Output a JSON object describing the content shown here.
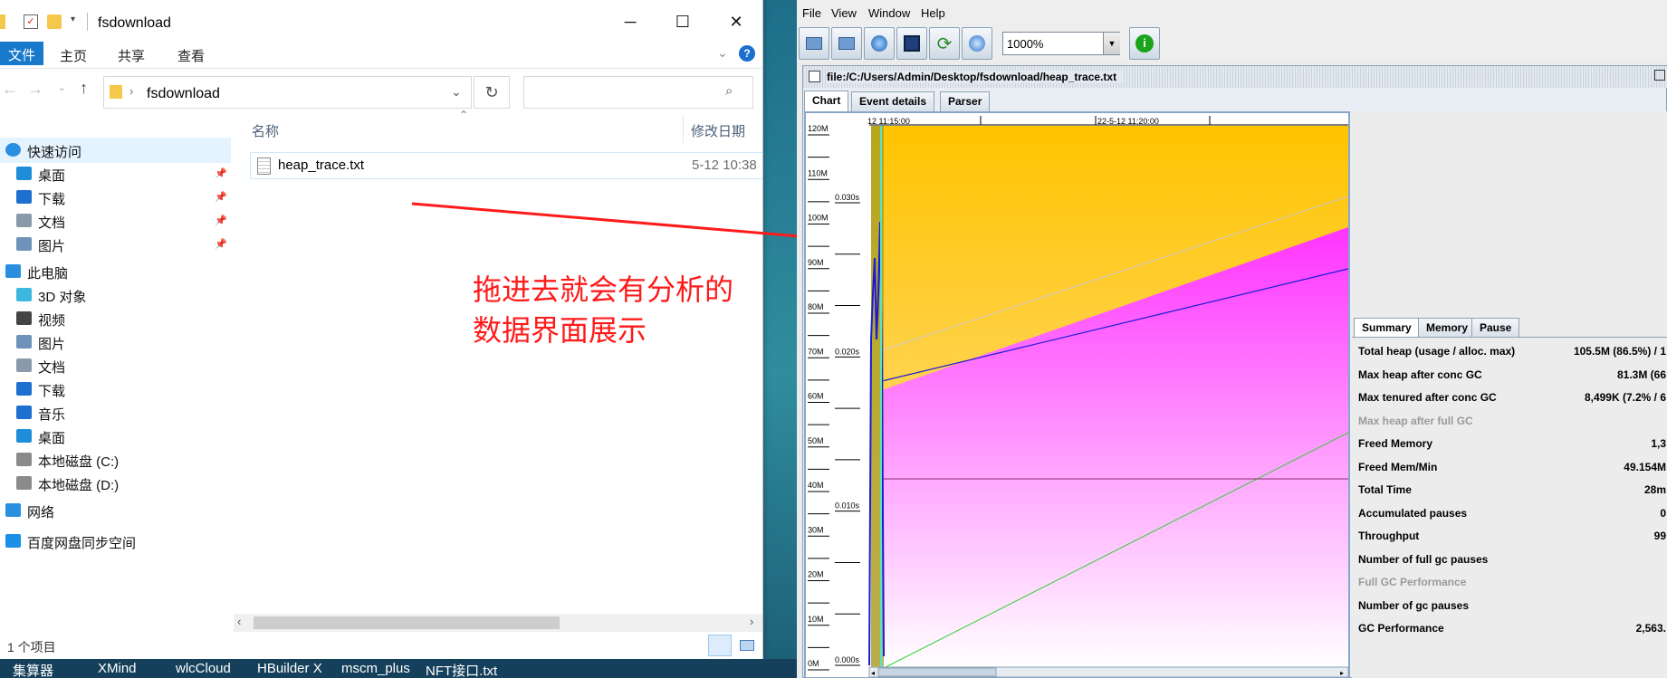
{
  "explorer": {
    "title": "fsdownload",
    "ribbon": {
      "file": "文件",
      "home": "主页",
      "share": "共享",
      "view": "查看"
    },
    "address": "fsdownload",
    "nav": [
      {
        "label": "快速访问",
        "icon": "star-icon",
        "pinned": false
      },
      {
        "label": "桌面",
        "icon": "desktop-icon",
        "pinned": true
      },
      {
        "label": "下载",
        "icon": "download-icon",
        "pinned": true
      },
      {
        "label": "文档",
        "icon": "document-icon",
        "pinned": true
      },
      {
        "label": "图片",
        "icon": "picture-icon",
        "pinned": true
      },
      {
        "label": "此电脑",
        "icon": "computer-icon",
        "pinned": false
      },
      {
        "label": "3D 对象",
        "icon": "cube-icon",
        "pinned": false
      },
      {
        "label": "视频",
        "icon": "video-icon",
        "pinned": false
      },
      {
        "label": "图片",
        "icon": "picture-icon",
        "pinned": false
      },
      {
        "label": "文档",
        "icon": "document-icon",
        "pinned": false
      },
      {
        "label": "下载",
        "icon": "download-icon",
        "pinned": false
      },
      {
        "label": "音乐",
        "icon": "music-icon",
        "pinned": false
      },
      {
        "label": "桌面",
        "icon": "desktop-icon",
        "pinned": false
      },
      {
        "label": "本地磁盘 (C:)",
        "icon": "drive-icon",
        "pinned": false
      },
      {
        "label": "本地磁盘 (D:)",
        "icon": "drive-icon",
        "pinned": false
      },
      {
        "label": "网络",
        "icon": "network-icon",
        "pinned": false
      },
      {
        "label": "百度网盘同步空间",
        "icon": "cloud-sync-icon",
        "pinned": false
      }
    ],
    "columns": {
      "name": "名称",
      "date": "修改日期"
    },
    "files": [
      {
        "name": "heap_trace.txt",
        "date": "5-12 10:38"
      }
    ],
    "status": "1 个项目"
  },
  "annotation": {
    "line1": "拖进去就会有分析的",
    "line2": "数据界面展示",
    "color": "#ff1a1a"
  },
  "taskbar": [
    "集算器",
    "XMind",
    "wlcCloud",
    "HBuilder X",
    "mscm_plus",
    "NFT接口.txt"
  ],
  "gcviewer": {
    "menu": [
      "File",
      "View",
      "Window",
      "Help"
    ],
    "zoom": "1000%",
    "doc_title": "file:/C:/Users/Admin/Desktop/fsdownload/heap_trace.txt",
    "tabs": [
      "Chart",
      "Event details",
      "Parser"
    ],
    "chart": {
      "time_labels": [
        "12 11:15:00",
        "22-5-12 11:20:00"
      ],
      "mem_ticks": [
        "120M",
        "110M",
        "100M",
        "90M",
        "80M",
        "70M",
        "60M",
        "50M",
        "40M",
        "30M",
        "20M",
        "10M",
        "0M"
      ],
      "pause_ticks": [
        "0.030s",
        "0.020s",
        "0.010s",
        "0.000s"
      ]
    },
    "side_tabs": [
      "Summary",
      "Memory",
      "Pause"
    ],
    "summary": [
      {
        "k": "Total heap (usage / alloc. max)",
        "v": "105.5M (86.5%) / 1",
        "dim": false
      },
      {
        "k": "Max heap after conc GC",
        "v": "81.3M (66",
        "dim": false
      },
      {
        "k": "Max tenured after conc GC",
        "v": "8,499K (7.2% / 6",
        "dim": false
      },
      {
        "k": "Max heap after full GC",
        "v": "",
        "dim": true
      },
      {
        "k": "Freed Memory",
        "v": "1,3",
        "dim": false
      },
      {
        "k": "Freed Mem/Min",
        "v": "49.154M",
        "dim": false
      },
      {
        "k": "Total Time",
        "v": "28m",
        "dim": false
      },
      {
        "k": "Accumulated pauses",
        "v": "0",
        "dim": false
      },
      {
        "k": "Throughput",
        "v": "99",
        "dim": false
      },
      {
        "k": "Number of full gc pauses",
        "v": "",
        "dim": false
      },
      {
        "k": "Full GC Performance",
        "v": "",
        "dim": true
      },
      {
        "k": "Number of gc pauses",
        "v": "",
        "dim": false
      },
      {
        "k": "GC Performance",
        "v": "2,563.",
        "dim": false
      }
    ]
  }
}
